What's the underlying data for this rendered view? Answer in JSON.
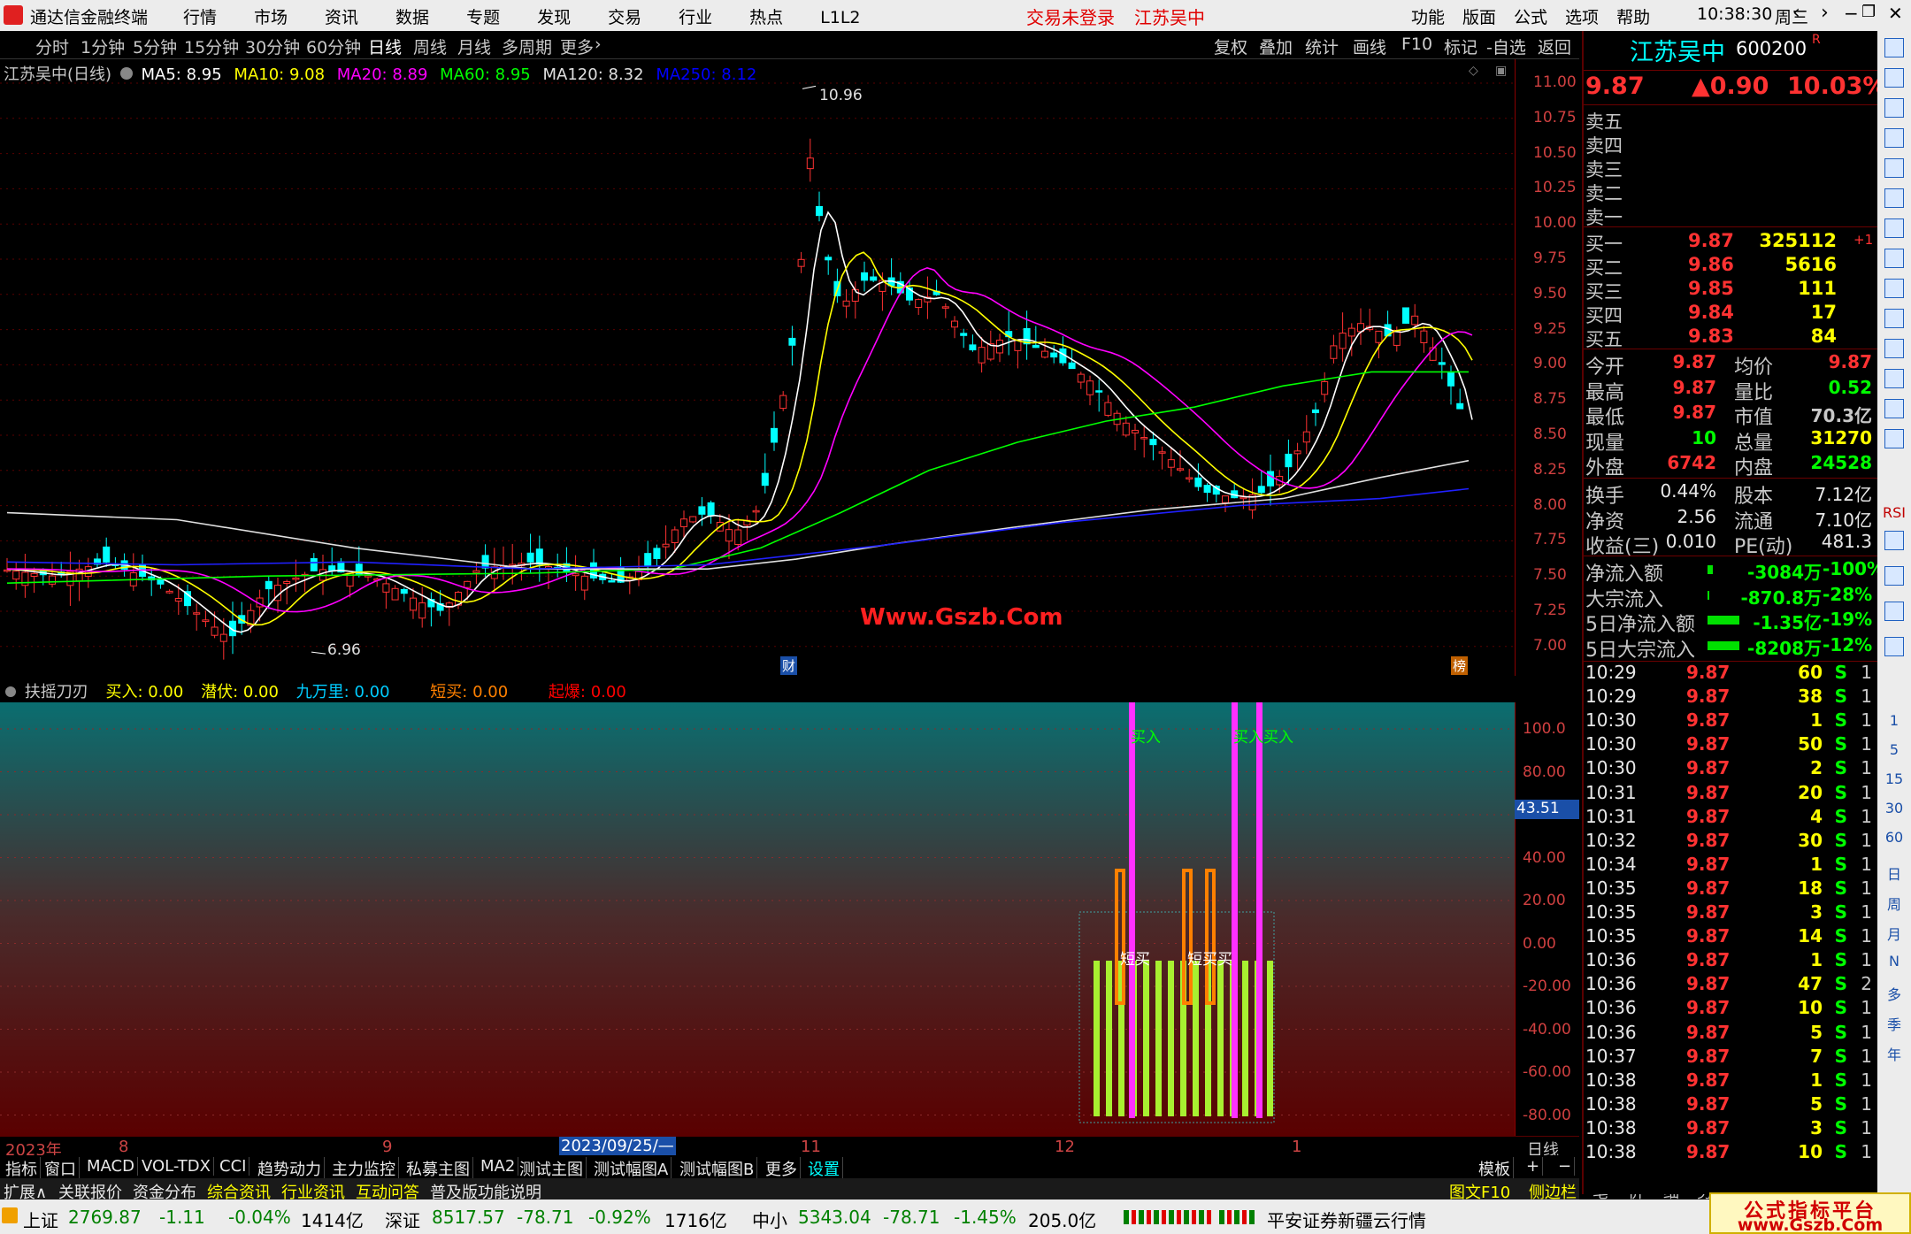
{
  "titlebar": {
    "app_name": "通达信金融终端",
    "menus": [
      "行情",
      "市场",
      "资讯",
      "数据",
      "专题",
      "发现",
      "交易",
      "行业",
      "热点",
      "L1L2"
    ],
    "status_login": "交易未登录",
    "stock_tab": "江苏吴中",
    "right_menus": [
      "功能",
      "版面",
      "公式",
      "选项",
      "帮助"
    ],
    "time": "10:38:30",
    "weekday": "周三"
  },
  "periods": [
    "分时",
    "1分钟",
    "5分钟",
    "15分钟",
    "30分钟",
    "60分钟",
    "日线",
    "周线",
    "月线",
    "多周期",
    "更多"
  ],
  "active_period": "日线",
  "tools": [
    "复权",
    "叠加",
    "统计",
    "画线",
    "F10",
    "标记",
    "-自选",
    "返回"
  ],
  "main": {
    "stock_label": "江苏吴中(日线)",
    "ma": [
      {
        "label": "MA5: 8.95",
        "color": "#ffffff"
      },
      {
        "label": "MA10: 9.08",
        "color": "#ffff00"
      },
      {
        "label": "MA20: 8.89",
        "color": "#ff00ff"
      },
      {
        "label": "MA60: 8.95",
        "color": "#00ff00"
      },
      {
        "label": "MA120: 8.32",
        "color": "#e0e0e0"
      },
      {
        "label": "MA250: 8.12",
        "color": "#0000ff"
      }
    ],
    "high_label": "10.96",
    "low_label": "6.96",
    "watermark": "Www.Gszb.Com",
    "cai_marker": "财",
    "bang_marker": "榜",
    "price_axis": [
      "11.00",
      "10.75",
      "10.50",
      "10.25",
      "10.00",
      "9.75",
      "9.50",
      "9.25",
      "9.00",
      "8.75",
      "8.50",
      "8.25",
      "8.00",
      "7.75",
      "7.50",
      "7.25",
      "7.00"
    ]
  },
  "indicator": {
    "name": "扶摇刀刃",
    "values": [
      {
        "label": "买入: 0.00",
        "color": "#ffff00"
      },
      {
        "label": "潜伏: 0.00",
        "color": "#ffff00"
      },
      {
        "label": "九万里: 0.00",
        "color": "#00ccff"
      },
      {
        "label": "短买: 0.00",
        "color": "#ff8000"
      },
      {
        "label": "起爆: 0.00",
        "color": "#ff0000"
      }
    ],
    "axis": [
      "100.0",
      "80.00",
      "60.00",
      "40.00",
      "20.00",
      "0.00",
      "-20.00",
      "-40.00",
      "-60.00",
      "-80.00"
    ],
    "current_value": "43.51",
    "buy_labels": [
      "买入",
      "买入买入"
    ],
    "short_buy_labels": [
      "短买",
      "短买买"
    ]
  },
  "xaxis": {
    "labels": [
      "2023年",
      "8",
      "9",
      "2023/09/25/—",
      "11",
      "12",
      "1"
    ],
    "right_label": "日线"
  },
  "tabs1": [
    "指标",
    "窗口",
    "MACD",
    "VOL-TDX",
    "CCI",
    "趋势动力",
    "主力监控",
    "私募主图",
    "MA2",
    "测试主图",
    "测试幅图A",
    "测试幅图B",
    "更多",
    "设置"
  ],
  "tabs1_right": [
    "模板",
    "+",
    "−"
  ],
  "tabs2": [
    "扩展∧",
    "关联报价",
    "资金分布",
    "综合资讯",
    "行业资讯",
    "互动问答",
    "普及版功能说明"
  ],
  "tabs2_right": [
    "图文F10",
    "侧边栏《",
    "笔",
    "价",
    "细",
    "势"
  ],
  "quote": {
    "name": "江苏吴中",
    "code": "600200",
    "r": "R",
    "price": "9.87",
    "change": "▲0.90",
    "pct": "10.03%",
    "asks": [
      "卖五",
      "卖四",
      "卖三",
      "卖二",
      "卖一"
    ],
    "bids": [
      {
        "label": "买一",
        "price": "9.87",
        "vol": "325112",
        "diff": "+1"
      },
      {
        "label": "买二",
        "price": "9.86",
        "vol": "5616",
        "diff": ""
      },
      {
        "label": "买三",
        "price": "9.85",
        "vol": "111",
        "diff": ""
      },
      {
        "label": "买四",
        "price": "9.84",
        "vol": "17",
        "diff": ""
      },
      {
        "label": "买五",
        "price": "9.83",
        "vol": "84",
        "diff": ""
      }
    ],
    "stats": [
      {
        "l1": "今开",
        "v1": "9.87",
        "l2": "均价",
        "v2": "9.87"
      },
      {
        "l1": "最高",
        "v1": "9.87",
        "l2": "量比",
        "v2": "0.52"
      },
      {
        "l1": "最低",
        "v1": "9.87",
        "l2": "市值",
        "v2": "70.3亿"
      },
      {
        "l1": "现量",
        "v1": "10",
        "l2": "总量",
        "v2": "31270"
      },
      {
        "l1": "外盘",
        "v1": "6742",
        "l2": "内盘",
        "v2": "24528"
      }
    ],
    "stats2": [
      {
        "l1": "换手",
        "v1": "0.44%",
        "l2": "股本",
        "v2": "7.12亿"
      },
      {
        "l1": "净资",
        "v1": "2.56",
        "l2": "流通",
        "v2": "7.10亿"
      },
      {
        "l1": "收益(三)",
        "v1": "0.010",
        "l2": "PE(动)",
        "v2": "481.3"
      }
    ],
    "flows": [
      {
        "label": "净流入额",
        "val": "-3084万",
        "pct": "-100%"
      },
      {
        "label": "大宗流入",
        "val": "-870.8万",
        "pct": "-28%"
      },
      {
        "label": "5日净流入额",
        "val": "-1.35亿",
        "pct": "-19%"
      },
      {
        "label": "5日大宗流入",
        "val": "-8208万",
        "pct": "-12%"
      }
    ],
    "ticks": [
      {
        "t": "10:29",
        "p": "9.87",
        "v": "60",
        "s": "S",
        "n": "1"
      },
      {
        "t": "10:29",
        "p": "9.87",
        "v": "38",
        "s": "S",
        "n": "1"
      },
      {
        "t": "10:30",
        "p": "9.87",
        "v": "1",
        "s": "S",
        "n": "1"
      },
      {
        "t": "10:30",
        "p": "9.87",
        "v": "50",
        "s": "S",
        "n": "1"
      },
      {
        "t": "10:30",
        "p": "9.87",
        "v": "2",
        "s": "S",
        "n": "1"
      },
      {
        "t": "10:31",
        "p": "9.87",
        "v": "20",
        "s": "S",
        "n": "1"
      },
      {
        "t": "10:31",
        "p": "9.87",
        "v": "4",
        "s": "S",
        "n": "1"
      },
      {
        "t": "10:32",
        "p": "9.87",
        "v": "30",
        "s": "S",
        "n": "1"
      },
      {
        "t": "10:34",
        "p": "9.87",
        "v": "1",
        "s": "S",
        "n": "1"
      },
      {
        "t": "10:35",
        "p": "9.87",
        "v": "18",
        "s": "S",
        "n": "1"
      },
      {
        "t": "10:35",
        "p": "9.87",
        "v": "3",
        "s": "S",
        "n": "1"
      },
      {
        "t": "10:35",
        "p": "9.87",
        "v": "14",
        "s": "S",
        "n": "1"
      },
      {
        "t": "10:36",
        "p": "9.87",
        "v": "1",
        "s": "S",
        "n": "1"
      },
      {
        "t": "10:36",
        "p": "9.87",
        "v": "47",
        "s": "S",
        "n": "2"
      },
      {
        "t": "10:36",
        "p": "9.87",
        "v": "10",
        "s": "S",
        "n": "1"
      },
      {
        "t": "10:36",
        "p": "9.87",
        "v": "5",
        "s": "S",
        "n": "1"
      },
      {
        "t": "10:37",
        "p": "9.87",
        "v": "7",
        "s": "S",
        "n": "1"
      },
      {
        "t": "10:38",
        "p": "9.87",
        "v": "1",
        "s": "S",
        "n": "1"
      },
      {
        "t": "10:38",
        "p": "9.87",
        "v": "5",
        "s": "S",
        "n": "1"
      },
      {
        "t": "10:38",
        "p": "9.87",
        "v": "3",
        "s": "S",
        "n": "1"
      },
      {
        "t": "10:38",
        "p": "9.87",
        "v": "10",
        "s": "S",
        "n": "1"
      }
    ]
  },
  "sidebar_texts": [
    "RSI",
    "1",
    "5",
    "15",
    "30",
    "60",
    "日",
    "周",
    "月",
    "N",
    "多",
    "季",
    "年"
  ],
  "status": {
    "sh_name": "上证",
    "sh_val": "2769.87",
    "sh_chg": "-1.11",
    "sh_pct": "-0.04%",
    "sh_amt": "1414亿",
    "sz_name": "深证",
    "sz_val": "8517.57",
    "sz_chg": "-78.71",
    "sz_pct": "-0.92%",
    "sz_amt": "1716亿",
    "zx_name": "中小",
    "zx_val": "5343.04",
    "zx_chg": "-78.71",
    "zx_pct": "-1.45%",
    "zx_amt": "205.0亿",
    "broker": "平安证券新疆云行情"
  },
  "corner_watermark": {
    "line1": "公式指标平台",
    "line2": "www.Gszb.Com"
  },
  "colors": {
    "up": "#ff3232",
    "down": "#00ffff",
    "accent_red": "#ff0000",
    "green": "#00ff00",
    "yellow": "#ffff00"
  }
}
